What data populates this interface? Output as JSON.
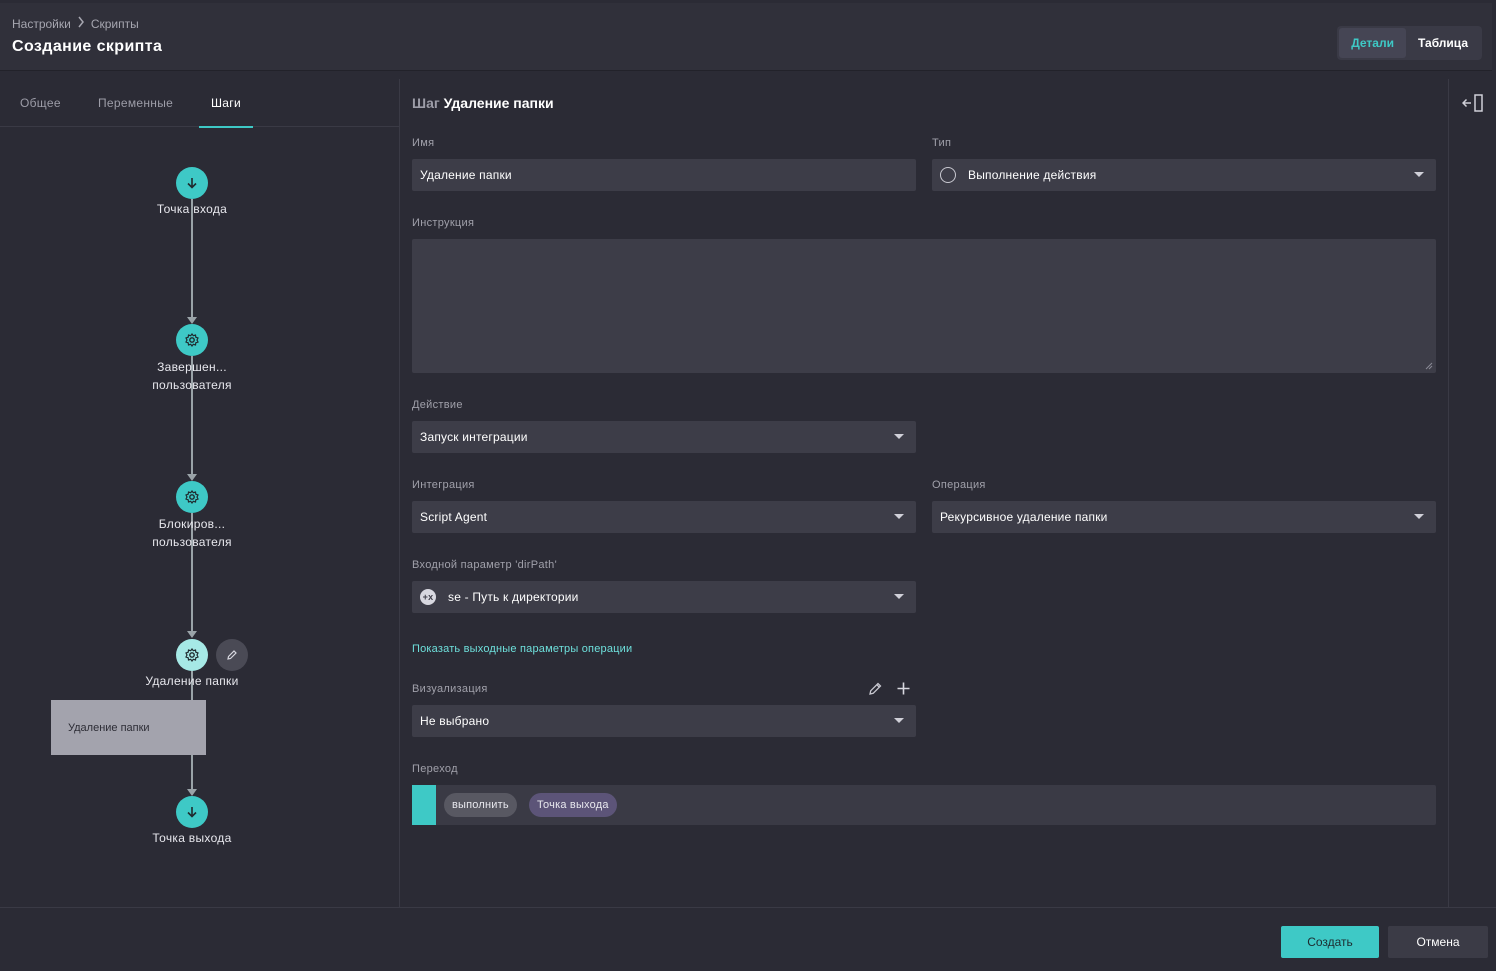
{
  "header": {
    "breadcrumb": [
      "Настройки",
      "Скрипты"
    ],
    "title": "Создание скрипта",
    "view_toggle": [
      "Детали",
      "Таблица"
    ],
    "active_view": "Детали"
  },
  "left": {
    "tabs": [
      "Общее",
      "Переменные",
      "Шаги"
    ],
    "active_tab": "Шаги",
    "nodes": {
      "entry": "Точка входа",
      "step1_line1": "Завершен...",
      "step1_line2": "пользователя",
      "step2_line1": "Блокиров...",
      "step2_line2": "пользователя",
      "step3": "Удаление папки",
      "exit": "Точка выхода"
    },
    "tooltip": "Удаление папки"
  },
  "form": {
    "step_prefix": "Шаг",
    "step_name": "Удаление папки",
    "name_label": "Имя",
    "name_value": "Удаление папки",
    "type_label": "Тип",
    "type_value": "Выполнение действия",
    "instruction_label": "Инструкция",
    "instruction_value": "",
    "action_label": "Действие",
    "action_value": "Запуск интеграции",
    "integration_label": "Интеграция",
    "integration_value": "Script Agent",
    "operation_label": "Операция",
    "operation_value": "Рекурсивное удаление папки",
    "input_param_label": "Входной параметр 'dirPath'",
    "input_param_icon": "+x",
    "input_param_value": "se - Путь к директории",
    "show_outputs_link": "Показать выходные параметры операции",
    "visualization_label": "Визуализация",
    "visualization_value": "Не выбрано",
    "transition_label": "Переход",
    "transition_action": "выполнить",
    "transition_target": "Точка выхода"
  },
  "footer": {
    "create": "Создать",
    "cancel": "Отмена"
  },
  "colors": {
    "accent": "#3ec9c6",
    "background": "#2b2b35",
    "field": "#3d3d48"
  }
}
